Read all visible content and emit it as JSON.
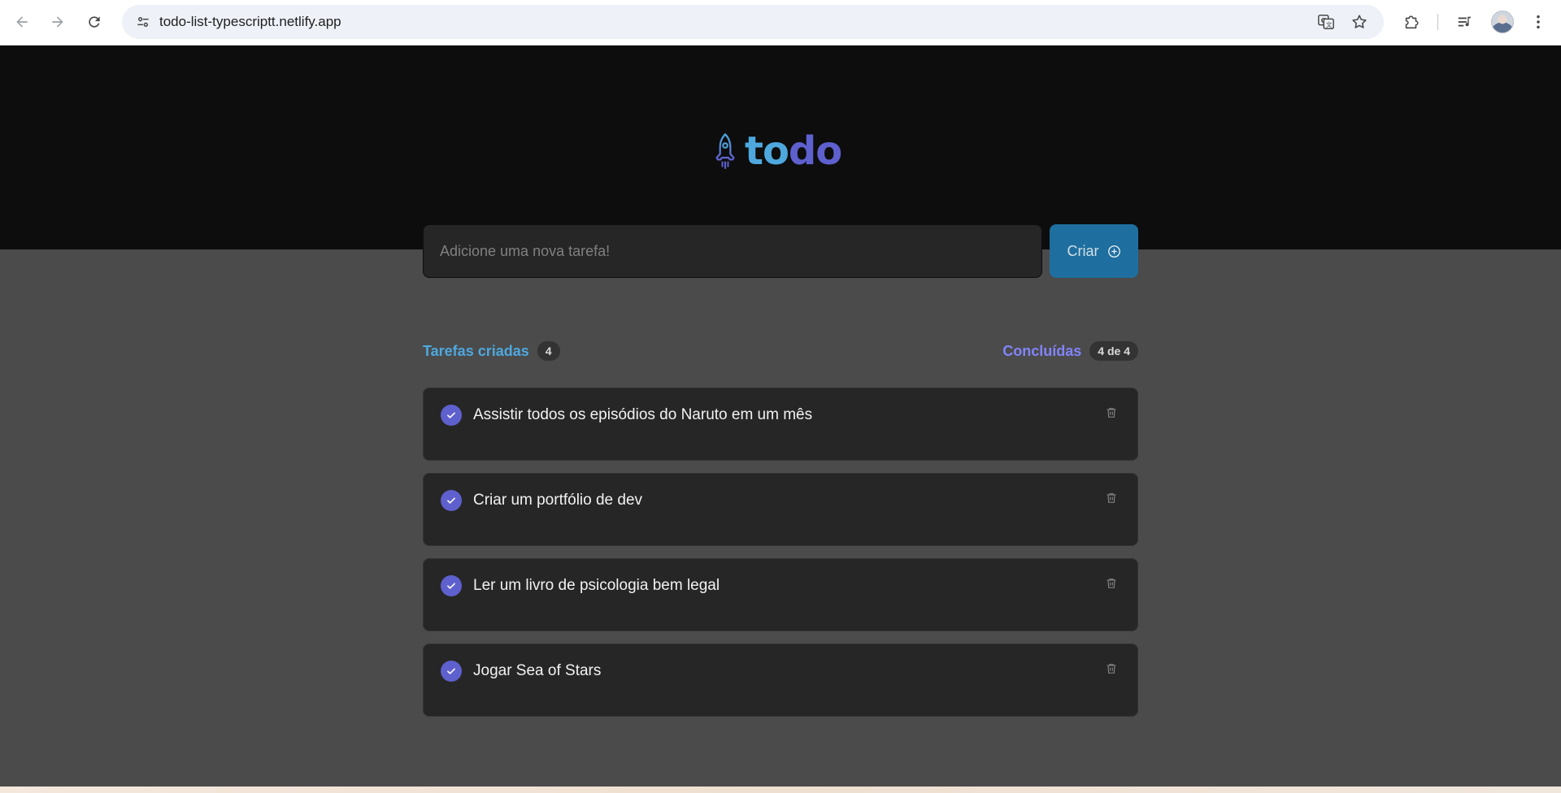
{
  "browser": {
    "url": "todo-list-typescriptt.netlify.app",
    "icons": {
      "back": "back-arrow-icon",
      "forward": "forward-arrow-icon",
      "reload": "reload-icon",
      "site_info": "tune-icon",
      "translate": "translate-icon",
      "bookmark": "star-icon",
      "extensions": "puzzle-icon",
      "media": "media-queue-icon",
      "menu": "kebab-menu-icon"
    }
  },
  "app": {
    "logo_to": "to",
    "logo_do": "do",
    "input_placeholder": "Adicione uma nova tarefa!",
    "create_label": "Criar",
    "created_label": "Tarefas criadas",
    "created_count": "4",
    "done_label": "Concluídas",
    "done_count": "4 de 4",
    "tasks": [
      {
        "text": "Assistir todos os episódios do Naruto em um mês",
        "done": true
      },
      {
        "text": "Criar um portfólio de dev",
        "done": true
      },
      {
        "text": "Ler um livro de psicologia bem legal",
        "done": true
      },
      {
        "text": "Jogar Sea of Stars",
        "done": true
      }
    ]
  },
  "colors": {
    "header_bg": "#0d0d0d",
    "body_bg": "#4b4b4b",
    "card_bg": "#262626",
    "blue": "#4ea8de",
    "purple": "#5e60ce",
    "purple_light": "#8284fa",
    "button": "#1e6f9f"
  }
}
